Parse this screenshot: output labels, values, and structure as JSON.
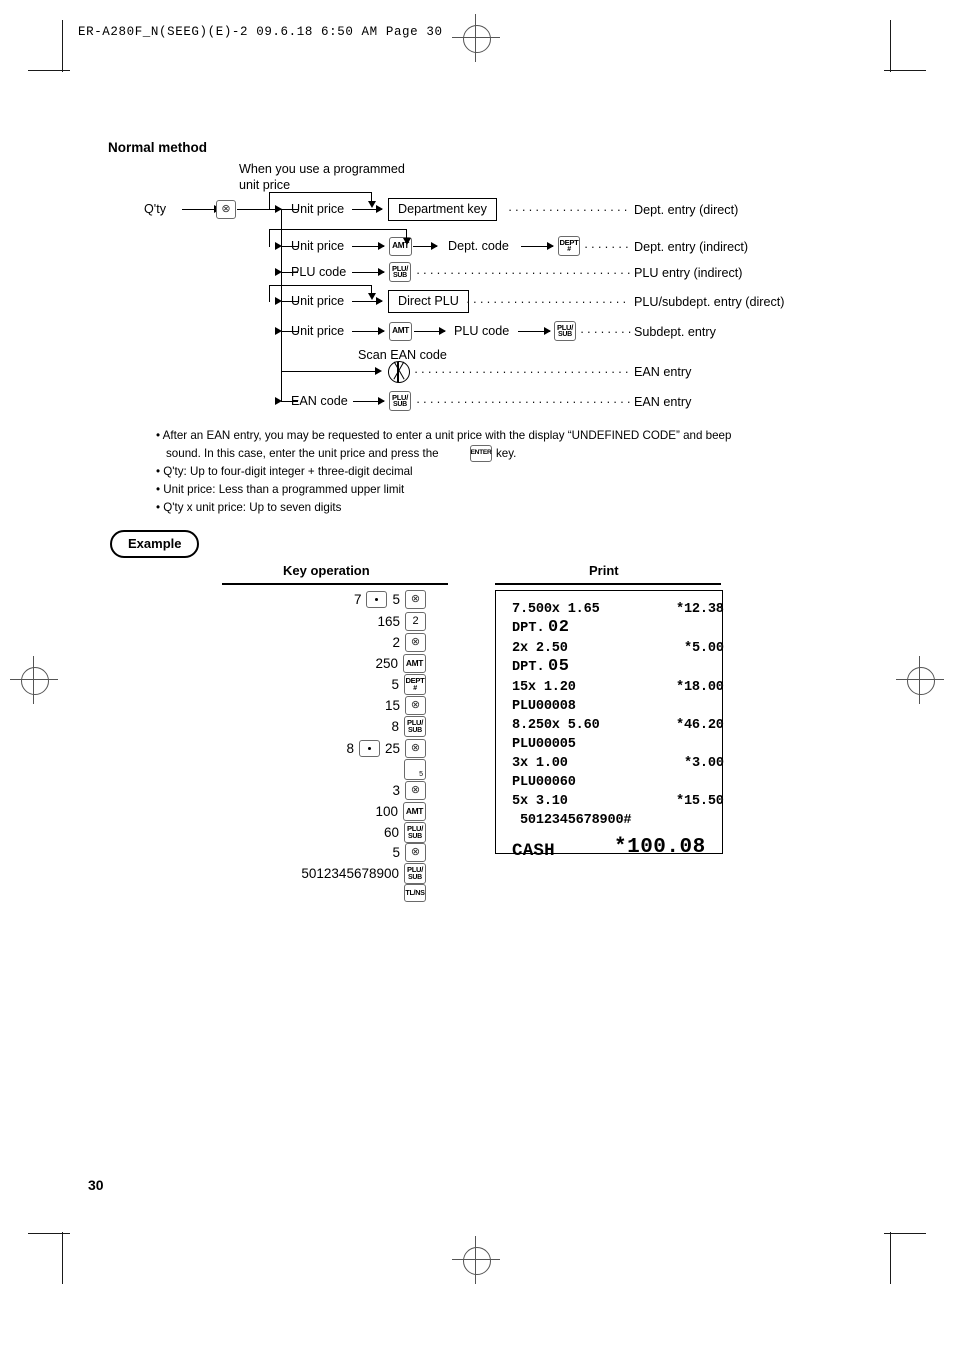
{
  "header": {
    "text": "ER-A280F_N(SEEG)(E)-2   09.6.18 6:50 AM  Page 30"
  },
  "section": {
    "title": "Normal method",
    "programmed_note_line1": "When you use a programmed",
    "programmed_note_line2": "unit price"
  },
  "diagram": {
    "start_label": "Q'ty",
    "scan_label": "Scan EAN code",
    "rows": [
      {
        "input": "Unit price",
        "target": "Department key",
        "target_kind": "box",
        "result": "Dept. entry (direct)",
        "has_bypass": true
      },
      {
        "input": "Unit price",
        "key1": "AMT",
        "mid": "Dept. code",
        "key2": "DEPT #",
        "result": "Dept. entry (indirect)",
        "has_bypass": true
      },
      {
        "input": "PLU code",
        "key1": "PLU/SUB",
        "result": "PLU entry (indirect)",
        "has_bypass": false
      },
      {
        "input": "Unit price",
        "target": "Direct PLU",
        "target_kind": "box",
        "result": "PLU/subdept. entry (direct)",
        "has_bypass": true
      },
      {
        "input": "Unit price",
        "key1": "AMT",
        "mid": "PLU code",
        "key2": "PLU/SUB",
        "result": "Subdept. entry",
        "has_bypass": false
      },
      {
        "input": "",
        "key1": "scan",
        "result": "EAN entry",
        "has_bypass": false
      },
      {
        "input": "EAN code",
        "key1": "PLU/SUB",
        "result": "EAN entry",
        "has_bypass": false
      }
    ]
  },
  "notes": [
    "• After an EAN entry, you may be requested to enter a unit price with the display “UNDEFINED CODE” and beep",
    "sound. In this case, enter the unit price and press the",
    "key.",
    "• Q'ty: Up to four-digit integer + three-digit decimal",
    "• Unit price: Less than a programmed upper limit",
    "• Q'ty x unit price: Up to seven digits"
  ],
  "notes_inline_key": "ENTER",
  "example": {
    "badge": "Example",
    "key_operation_header": "Key operation",
    "print_header": "Print",
    "operations": [
      {
        "digits": "7",
        "sep": "dot",
        "digits2": "5",
        "key": "X"
      },
      {
        "digits": "165",
        "key": "2"
      },
      {
        "digits": "2",
        "key": "X"
      },
      {
        "digits": "250",
        "key": "AMT"
      },
      {
        "digits": "5",
        "key": "DEPT #"
      },
      {
        "digits": "15",
        "key": "X"
      },
      {
        "digits": "8",
        "key": "PLU/SUB"
      },
      {
        "digits": "8",
        "sep": "dot",
        "digits2": "25",
        "key": "X"
      },
      {
        "digits": "",
        "key": "DIRECT-PLU-5"
      },
      {
        "digits": "3",
        "key": "X"
      },
      {
        "digits": "100",
        "key": "AMT"
      },
      {
        "digits": "60",
        "key": "PLU/SUB"
      },
      {
        "digits": "5",
        "key": "X"
      },
      {
        "digits": "5012345678900",
        "key": "PLU/SUB"
      },
      {
        "digits": "",
        "key": "TL/NS"
      }
    ],
    "receipt_lines": [
      {
        "left": "7.500x 1.65",
        "right": "*12.38",
        "style": "norm"
      },
      {
        "left": "DPT.",
        "big": "02",
        "style": "dpt"
      },
      {
        "left": "2x 2.50",
        "right": "*5.00",
        "style": "norm"
      },
      {
        "left": "DPT.",
        "big": "05",
        "style": "dpt"
      },
      {
        "left": "15x 1.20",
        "right": "*18.00",
        "style": "norm"
      },
      {
        "left": "PLU00008",
        "right": "",
        "style": "norm"
      },
      {
        "left": "8.250x 5.60",
        "right": "*46.20",
        "style": "norm"
      },
      {
        "left": "PLU00005",
        "right": "",
        "style": "norm"
      },
      {
        "left": "3x 1.00",
        "right": "*3.00",
        "style": "norm"
      },
      {
        "left": "PLU00060",
        "right": "",
        "style": "norm"
      },
      {
        "left": "5x 3.10",
        "right": "*15.50",
        "style": "norm"
      },
      {
        "left": " 5012345678900#",
        "right": "",
        "style": "norm"
      }
    ],
    "receipt_total": {
      "label": "CASH",
      "amount": "*100.08"
    }
  },
  "page_number": "30"
}
